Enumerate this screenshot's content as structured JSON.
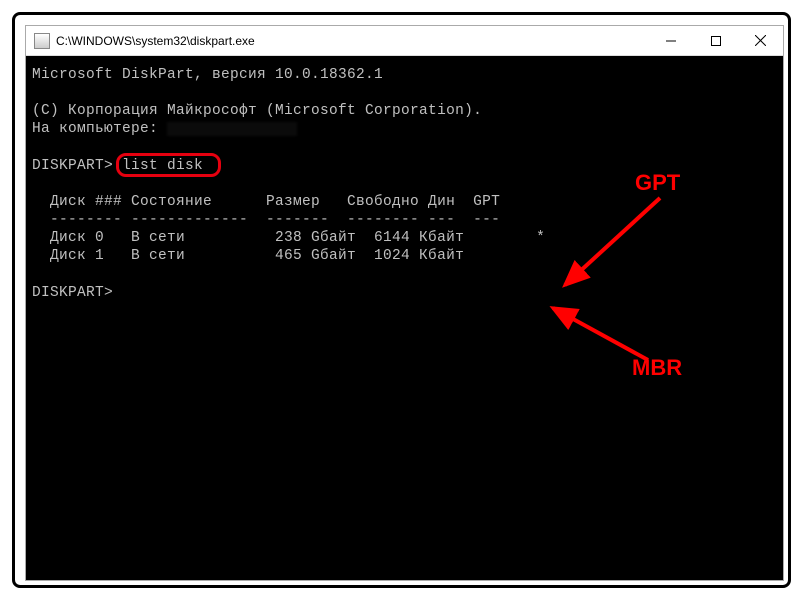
{
  "window": {
    "title": "C:\\WINDOWS\\system32\\diskpart.exe"
  },
  "terminal": {
    "version_line": "Microsoft DiskPart, версия 10.0.18362.1",
    "blank": "",
    "copyright_line": "(C) Корпорация Майкрософт (Microsoft Corporation).",
    "computer_prefix": "На компьютере: ",
    "prompt1_prefix": "DISKPART> ",
    "command": "list disk",
    "header": "  Диск ### Состояние      Размер   Свободно Дин  GPT",
    "divider": "  -------- -------------  -------  -------- ---  ---",
    "row0": "  Диск 0   В сети          238 Gбайт  6144 Кбайт        *",
    "row1": "  Диск 1   В сети          465 Gбайт  1024 Кбайт",
    "prompt2": "DISKPART>"
  },
  "annotations": {
    "gpt": "GPT",
    "mbr": "MBR"
  }
}
